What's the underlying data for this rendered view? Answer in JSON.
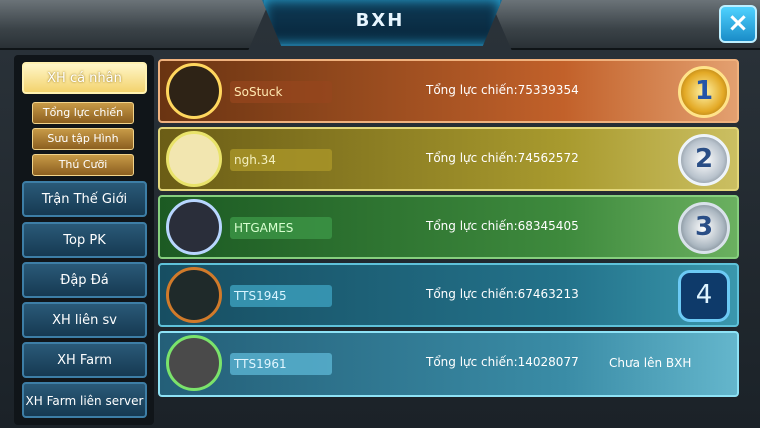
{
  "header": {
    "title": "BXH",
    "close_icon": "×"
  },
  "sidebar": {
    "active": "XH cá nhân",
    "subtabs": [
      "Tổng lực chiến",
      "Sưu tập Hình",
      "Thú Cưỡi"
    ],
    "buttons": [
      "Trận Thế Giới",
      "Top PK",
      "Đập Đá",
      "XH liên sv",
      "XH Farm",
      "XH Farm liên server"
    ]
  },
  "ranking": [
    {
      "name": "SoStuck",
      "power": "Tổng lực chiến:75339354",
      "rank": "1"
    },
    {
      "name": "ngh.34",
      "power": "Tổng lực chiến:74562572",
      "rank": "2"
    },
    {
      "name": "HTGAMES",
      "power": "Tổng lực chiến:68345405",
      "rank": "3"
    },
    {
      "name": "TTS1945",
      "power": "Tổng lực chiến:67463213",
      "rank": "4"
    },
    {
      "name": "TTS1961",
      "power": "Tổng lực chiến:14028077",
      "rank_text": "Chưa lên BXH"
    }
  ]
}
